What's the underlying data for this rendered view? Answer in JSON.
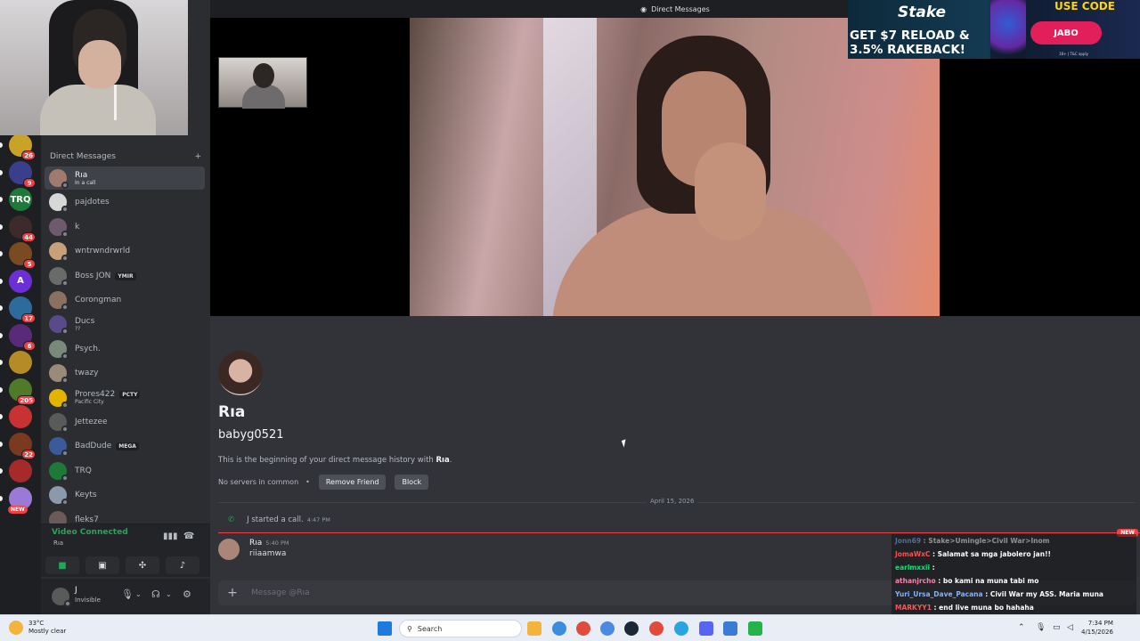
{
  "topbar": {
    "title": "Direct Messages"
  },
  "rail": {
    "servers": [
      {
        "badge": "26",
        "color": "#c9a228",
        "label": ""
      },
      {
        "badge": "9",
        "color": "#3a3f8c",
        "label": ""
      },
      {
        "badge": "",
        "color": "#1e7a38",
        "label": "TRQ"
      },
      {
        "badge": "44",
        "color": "#3d2a2a",
        "label": ""
      },
      {
        "badge": "5",
        "color": "#7a4b20",
        "label": ""
      },
      {
        "badge": "",
        "color": "#6c2fd6",
        "label": "A"
      },
      {
        "badge": "17",
        "color": "#2c6b9c",
        "label": ""
      },
      {
        "badge": "6",
        "color": "#5a2a7a",
        "label": ""
      },
      {
        "badge": "",
        "color": "#b58b27",
        "label": ""
      },
      {
        "badge": "205",
        "color": "#4e7a29",
        "label": ""
      },
      {
        "badge": "",
        "color": "#c83232",
        "label": ""
      },
      {
        "badge": "22",
        "color": "#7a3a20",
        "label": ""
      },
      {
        "badge": "",
        "color": "#a52a2a",
        "label": ""
      },
      {
        "badge": "",
        "color": "#9a7ad6",
        "label": ""
      }
    ],
    "new_label": "NEW"
  },
  "sidebar": {
    "header": "Direct Messages",
    "add": "+",
    "dms": [
      {
        "name": "Rıa",
        "sub": "In a call",
        "tag": "",
        "color": "#a07a6e"
      },
      {
        "name": "pajdotes",
        "sub": "",
        "tag": "",
        "color": "#d7d7d7"
      },
      {
        "name": "k",
        "sub": "",
        "tag": "",
        "color": "#6d5a6a"
      },
      {
        "name": "wntrwndrwrld",
        "sub": "",
        "tag": "",
        "color": "#c8a07a"
      },
      {
        "name": "Boss JON",
        "sub": "",
        "tag": "YMIR",
        "color": "#6a6a6a"
      },
      {
        "name": "Corongman",
        "sub": "",
        "tag": "",
        "color": "#8a7060"
      },
      {
        "name": "Ducs",
        "sub": "??",
        "tag": "",
        "color": "#5a4a8a"
      },
      {
        "name": "Psych.",
        "sub": "",
        "tag": "",
        "color": "#7a8a7a"
      },
      {
        "name": "twazy",
        "sub": "",
        "tag": "",
        "color": "#9a8a7a"
      },
      {
        "name": "Prores422",
        "sub": "Pacific City",
        "tag": "PCTY",
        "color": "#e2b400"
      },
      {
        "name": "Jettezee",
        "sub": "",
        "tag": "",
        "color": "#5a5a5a"
      },
      {
        "name": "BadDude",
        "sub": "",
        "tag": "MEGA",
        "color": "#3a5a9a"
      },
      {
        "name": "TRQ",
        "sub": "",
        "tag": "",
        "color": "#1e7a38"
      },
      {
        "name": "Keyts",
        "sub": "",
        "tag": "",
        "color": "#8a9aaa"
      },
      {
        "name": "fleks7",
        "sub": "",
        "tag": "",
        "color": "#6a5a5a"
      }
    ]
  },
  "voice": {
    "title": "Video Connected",
    "channel": "Rıa"
  },
  "user": {
    "name": "J",
    "status": "Invisible"
  },
  "chat": {
    "profile_name": "Rıa",
    "username": "babyg0521",
    "intro_prefix": "This is the beginning of your direct message history with ",
    "intro_name": "Rıa",
    "intro_suffix": ".",
    "no_servers": "No servers in common",
    "remove_friend": "Remove Friend",
    "block": "Block",
    "date": "April 15, 2026",
    "system_msg": "J started a call.",
    "system_time": "4:47 PM",
    "new_label": "NEW",
    "msg_author": "Rıa",
    "msg_time": "5:40 PM",
    "msg_text": "riiaamwa",
    "composer_placeholder": "Message @Rıa"
  },
  "ad": {
    "brand": "Stake",
    "line1": "GET $7 RELOAD &",
    "line2": "3.5% RAKEBACK!",
    "use_code": "USE CODE",
    "code": "JABO",
    "small": "18+ | T&C apply"
  },
  "stream_chat": [
    {
      "user": "Jonn69",
      "text": "Stake>Umingle>Civil War>Inom",
      "color": "#8ab4f8"
    },
    {
      "user": "JomaWxC",
      "text": "Salamat sa mga jabolero jan!!",
      "color": "#ff4d4d"
    },
    {
      "user": "earlmxxii",
      "text": "",
      "color": "#00e676"
    },
    {
      "user": "athanjrcho",
      "text": "bo kami na muna tabi mo",
      "color": "#ff80ab"
    },
    {
      "user": "Yuri_Ursa_Dave_Pacana",
      "text": "Civil War my ASS. Maria muna",
      "color": "#82b1ff"
    },
    {
      "user": "MARKYY1",
      "text": "end live muna bo hahaha",
      "color": "#ff5252"
    }
  ],
  "taskbar": {
    "temp": "33°C",
    "weather": "Mostly clear",
    "search": "Search",
    "time": "7:34 PM",
    "date": "4/15/2026"
  }
}
